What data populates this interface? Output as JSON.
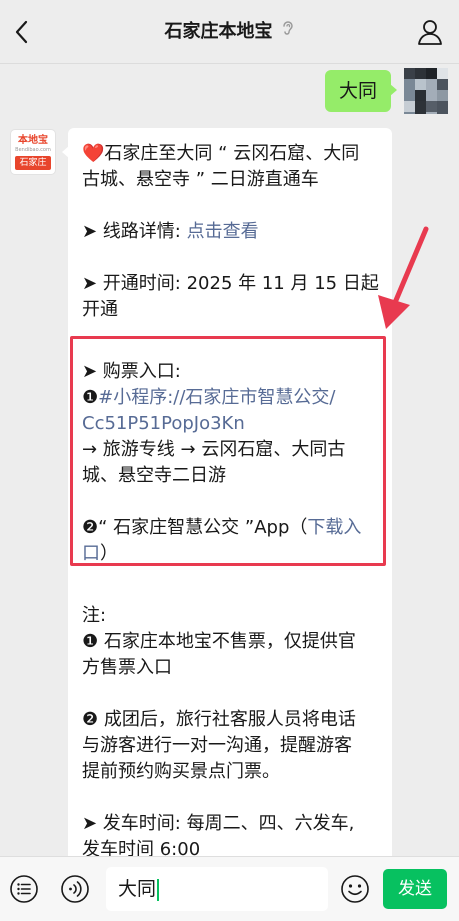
{
  "header": {
    "title": "石家庄本地宝"
  },
  "my_message": "大同",
  "bot": {
    "avatar_logo_top": "本地宝",
    "avatar_logo_mid": "Bendibao.com",
    "avatar_logo_bottom": "石家庄"
  },
  "article": {
    "title_heart": "❤️",
    "title_l1": "石家庄至大同 “ 云冈石窟、大同",
    "title_l2": "古城、悬空寺 ” 二日游直通车",
    "route_prefix": "➤ 线路详情: ",
    "route_link": "点击查看",
    "open_l1": "➤ 开通时间: 2025 年 11 月 15 日起",
    "open_l2": "开通",
    "ticket_head": "➤ 购票入口:",
    "ticket1_num": "❶",
    "ticket1_link_l1": "#小程序://石家庄市智慧公交/",
    "ticket1_link_l2": "Cc51P51PopJo3Kn",
    "ticket1_l3": "→ 旅游专线 → 云冈石窟、大同古",
    "ticket1_l4": "城、悬空寺二日游",
    "ticket2_prefix": "❷“ 石家庄智慧公交 ”App（",
    "ticket2_link_a": "下载入",
    "ticket2_link_b": "口",
    "ticket2_suffix": "）",
    "note_head": "注:",
    "note1_l1": "❶ 石家庄本地宝不售票，仅提供官",
    "note1_l2": "方售票入口",
    "note2_l1": "❷ 成团后，旅行社客服人员将电话",
    "note2_l2": "与游客进行一对一沟通，提醒游客",
    "note2_l3": "提前预约购买景点门票。",
    "depart_l1": "➤ 发车时间: 每周二、四、六发车,",
    "depart_l2": "发车时间 6:00"
  },
  "input": {
    "value": "大同"
  },
  "send_label": "发送",
  "colors": {
    "link": "#576b95",
    "my_bubble": "#95ec69",
    "send_button": "#07c160",
    "highlight_box": "#e83a4f"
  },
  "icons": [
    "back-icon",
    "ear-icon",
    "user-icon",
    "keyboard-icon",
    "voice-icon",
    "emoji-icon"
  ]
}
